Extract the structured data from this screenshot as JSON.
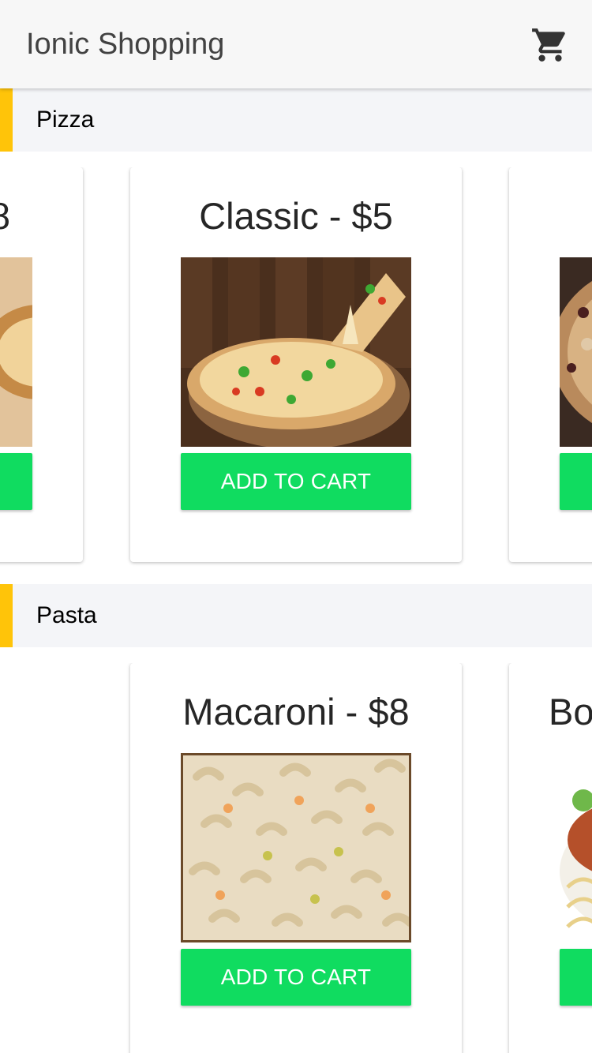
{
  "toolbar": {
    "title": "Ionic Shopping",
    "cart_icon": "cart-icon"
  },
  "colors": {
    "accent": "#ffc409",
    "button": "#10dc60",
    "section_bg": "#f4f5f8"
  },
  "categories": [
    {
      "label": "Pizza",
      "products": [
        {
          "title": "8",
          "button": "",
          "image": "pizza-photo"
        },
        {
          "title": "Classic - $5",
          "button": "ADD TO CART",
          "image": "pizza-photo"
        },
        {
          "title": "",
          "button": "",
          "image": "pizza-photo"
        }
      ]
    },
    {
      "label": "Pasta",
      "products": [
        {
          "title": "Macaroni - $8",
          "button": "ADD TO CART",
          "image": "macaroni-photo"
        },
        {
          "title": "Bo",
          "button": "",
          "image": "bolognese-photo"
        }
      ]
    }
  ]
}
